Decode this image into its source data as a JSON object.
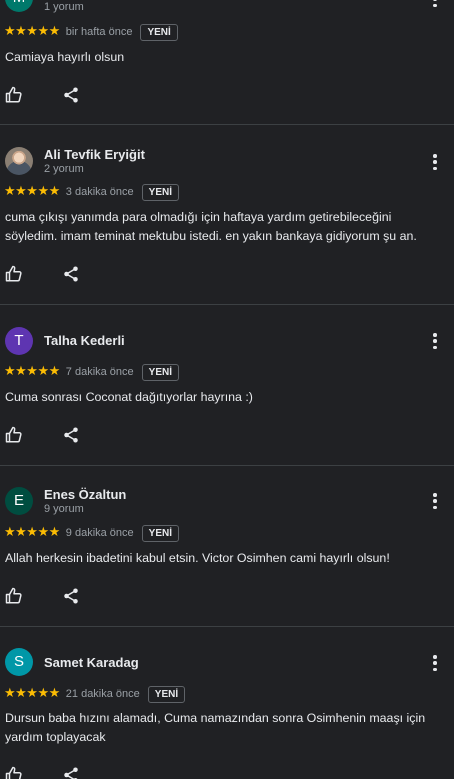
{
  "reviews": [
    {
      "avatar_letter": "M",
      "avatar_color": "#00796b",
      "name": "",
      "review_count": "1 yorum",
      "stars": "★★★★★",
      "time": "bir hafta önce",
      "badge": "YENİ",
      "text": "Camiaya hayırlı olsun"
    },
    {
      "avatar_letter": "",
      "avatar_color": "#8a7f73",
      "name": "Ali Tevfik Eryiğit",
      "review_count": "2 yorum",
      "stars": "★★★★★",
      "time": "3 dakika önce",
      "badge": "YENİ",
      "text": "cuma çıkışı yanımda para olmadığı için haftaya yardım getirebileceğini söyledim. imam teminat mektubu istedi. en yakın bankaya gidiyorum şu an."
    },
    {
      "avatar_letter": "T",
      "avatar_color": "#5e35b1",
      "name": "Talha Kederli",
      "review_count": "",
      "stars": "★★★★★",
      "time": "7 dakika önce",
      "badge": "YENİ",
      "text": "Cuma sonrası Coconat dağıtıyorlar hayrına :)"
    },
    {
      "avatar_letter": "E",
      "avatar_color": "#004d40",
      "name": "Enes Özaltun",
      "review_count": "9 yorum",
      "stars": "★★★★★",
      "time": "9 dakika önce",
      "badge": "YENİ",
      "text": "Allah herkesin ibadetini kabul etsin. Victor Osimhen cami hayırlı olsun!"
    },
    {
      "avatar_letter": "S",
      "avatar_color": "#0097a7",
      "name": "Samet Karadag",
      "review_count": "",
      "stars": "★★★★★",
      "time": "21 dakika önce",
      "badge": "YENİ",
      "text": "Dursun baba hızını alamadı, Cuma namazından sonra Osimhenin maaşı için yardım toplayacak"
    }
  ],
  "icons": {
    "like": "thumbs-up-icon",
    "share": "share-icon",
    "more": "more-vert-icon"
  },
  "colors": {
    "background": "#202124",
    "star": "#fbbc04",
    "secondary_text": "#9aa0a6",
    "divider": "#3c4043"
  }
}
